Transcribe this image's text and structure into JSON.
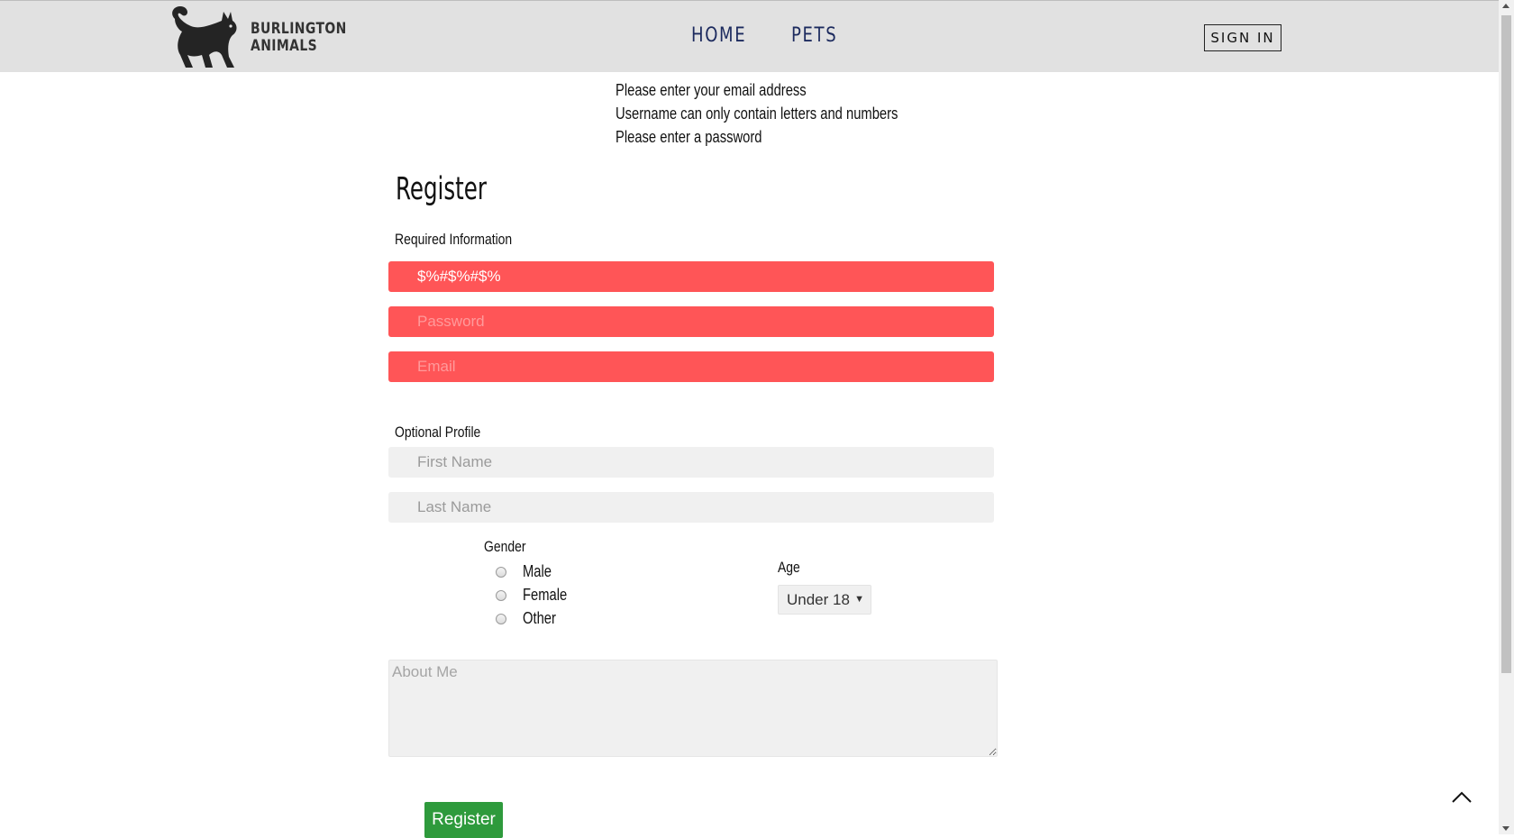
{
  "header": {
    "brand_line1": "BURLINGTON",
    "brand_line2": "ANIMALS",
    "nav": [
      {
        "label": "HOME"
      },
      {
        "label": "PETS"
      }
    ],
    "sign_in_label": "SIGN IN"
  },
  "errors": [
    "Please enter your email address",
    "Username can only contain letters and numbers",
    "Please enter a password"
  ],
  "form": {
    "title": "Register",
    "required_label": "Required Information",
    "username": {
      "value": "$%#$%#$%",
      "placeholder": ""
    },
    "password": {
      "value": "",
      "placeholder": "Password"
    },
    "email": {
      "value": "",
      "placeholder": "Email"
    },
    "optional_label": "Optional Profile",
    "first_name": {
      "placeholder": "First Name"
    },
    "last_name": {
      "placeholder": "Last Name"
    },
    "gender_label": "Gender",
    "gender_options": [
      "Male",
      "Female",
      "Other"
    ],
    "age_label": "Age",
    "age_selected": "Under 18",
    "about_placeholder": "About Me",
    "register_label": "Register"
  },
  "colors": {
    "error_field": "#ff5557",
    "optional_field": "#f0f0f0",
    "register_button": "#2e9a3c",
    "nav_text": "#1c2a5e",
    "header_bg": "#e1e1e1"
  },
  "icons": [
    "cat-logo-icon",
    "chevron-up-icon"
  ]
}
